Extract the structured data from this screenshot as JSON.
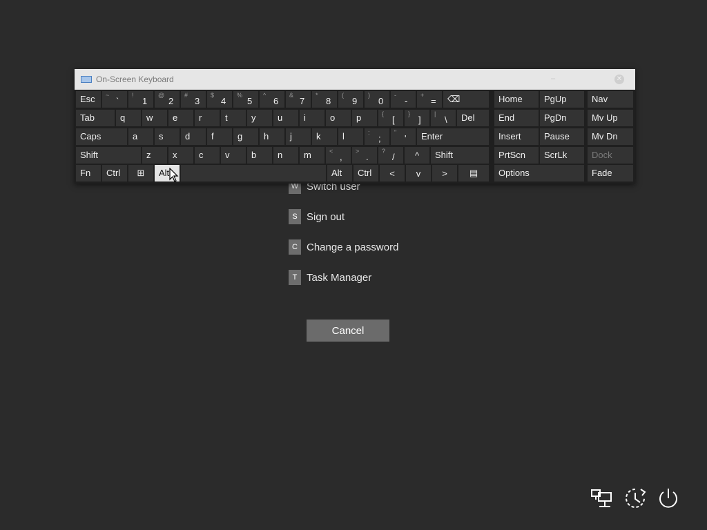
{
  "menu": {
    "items": [
      {
        "key": "W",
        "label": "Switch user"
      },
      {
        "key": "S",
        "label": "Sign out"
      },
      {
        "key": "C",
        "label": "Change a password"
      },
      {
        "key": "T",
        "label": "Task Manager"
      }
    ],
    "cancel_label": "Cancel"
  },
  "osk": {
    "title": "On-Screen Keyboard",
    "minimize_label": "–",
    "close_label": "✕",
    "keys": {
      "esc": "Esc",
      "tilde": {
        "sub": "~",
        "main": "`"
      },
      "d1": {
        "sub": "!",
        "main": "1"
      },
      "d2": {
        "sub": "@",
        "main": "2"
      },
      "d3": {
        "sub": "#",
        "main": "3"
      },
      "d4": {
        "sub": "$",
        "main": "4"
      },
      "d5": {
        "sub": "%",
        "main": "5"
      },
      "d6": {
        "sub": "^",
        "main": "6"
      },
      "d7": {
        "sub": "&",
        "main": "7"
      },
      "d8": {
        "sub": "*",
        "main": "8"
      },
      "d9": {
        "sub": "(",
        "main": "9"
      },
      "d0": {
        "sub": ")",
        "main": "0"
      },
      "minus": {
        "sub": "-",
        "main": "-"
      },
      "equals": {
        "sub": "+",
        "main": "="
      },
      "backspace": "⌫",
      "tab": "Tab",
      "q": "q",
      "w": "w",
      "e": "e",
      "r": "r",
      "t": "t",
      "y": "y",
      "u": "u",
      "i": "i",
      "o": "o",
      "p": "p",
      "lbracket": {
        "sub": "{",
        "main": "["
      },
      "rbracket": {
        "sub": "}",
        "main": "]"
      },
      "backslash": {
        "sub": "|",
        "main": "\\"
      },
      "del": "Del",
      "caps": "Caps",
      "a": "a",
      "s": "s",
      "d": "d",
      "f": "f",
      "g": "g",
      "h": "h",
      "j": "j",
      "k": "k",
      "l": "l",
      "semicolon": {
        "sub": ":",
        "main": ";"
      },
      "quote": {
        "sub": "\"",
        "main": "'"
      },
      "enter": "Enter",
      "shift_l": "Shift",
      "z": "z",
      "x": "x",
      "c": "c",
      "v": "v",
      "b": "b",
      "n": "n",
      "m": "m",
      "comma": {
        "sub": "<",
        "main": ","
      },
      "period": {
        "sub": ">",
        "main": "."
      },
      "slash": {
        "sub": "?",
        "main": "/"
      },
      "up": "^",
      "shift_r": "Shift",
      "fn": "Fn",
      "ctrl_l": "Ctrl",
      "win": "⊞",
      "alt_l": "Alt",
      "alt_r": "Alt",
      "ctrl_r": "Ctrl",
      "left": "<",
      "down": "v",
      "right": ">",
      "menu": "▤",
      "home": "Home",
      "pgup": "PgUp",
      "nav": "Nav",
      "end": "End",
      "pgdn": "PgDn",
      "mvup": "Mv Up",
      "insert": "Insert",
      "pause": "Pause",
      "mvdn": "Mv Dn",
      "prtscn": "PrtScn",
      "scrlk": "ScrLk",
      "dock": "Dock",
      "options": "Options",
      "fade": "Fade"
    }
  },
  "tray": {
    "icons": [
      "network-icon",
      "ease-of-access-icon",
      "power-icon"
    ]
  }
}
